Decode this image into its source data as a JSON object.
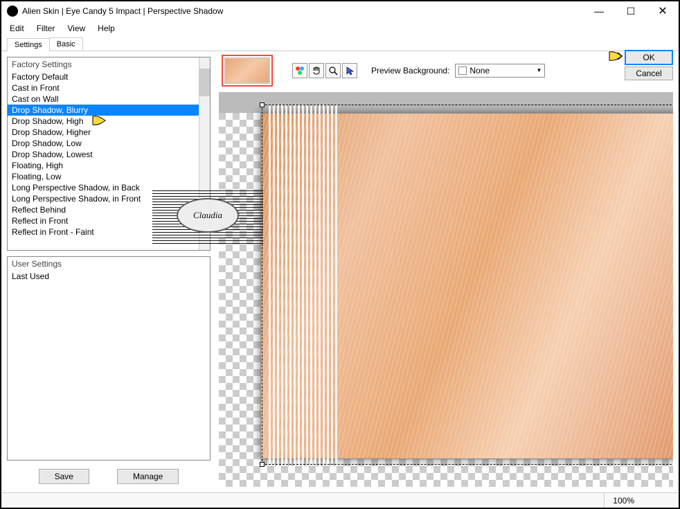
{
  "title": "Alien Skin | Eye Candy 5 Impact | Perspective Shadow",
  "menu": {
    "edit": "Edit",
    "filter": "Filter",
    "view": "View",
    "help": "Help"
  },
  "tabs": {
    "settings": "Settings",
    "basic": "Basic"
  },
  "factory": {
    "header": "Factory Settings",
    "items": [
      "Factory Default",
      "Cast in Front",
      "Cast on Wall",
      "Drop Shadow, Blurry",
      "Drop Shadow, High",
      "Drop Shadow, Higher",
      "Drop Shadow, Low",
      "Drop Shadow, Lowest",
      "Floating, High",
      "Floating, Low",
      "Long Perspective Shadow, in Back",
      "Long Perspective Shadow, in Front",
      "Reflect Behind",
      "Reflect in Front",
      "Reflect in Front - Faint"
    ],
    "selectedIndex": 3
  },
  "user": {
    "header": "User Settings",
    "items": [
      "Last Used"
    ]
  },
  "buttons": {
    "save": "Save",
    "manage": "Manage",
    "ok": "OK",
    "cancel": "Cancel"
  },
  "previewBg": {
    "label": "Preview Background:",
    "value": "None"
  },
  "status": {
    "zoom": "100%"
  },
  "watermark": "Claudia"
}
